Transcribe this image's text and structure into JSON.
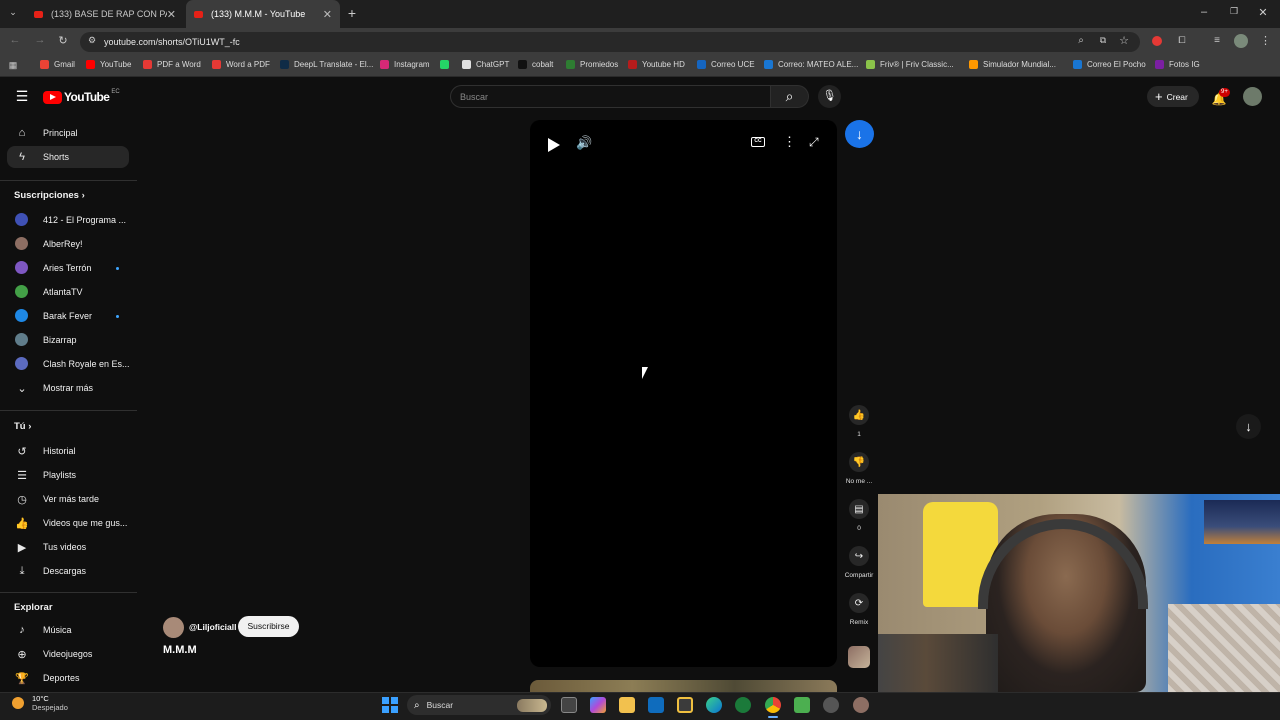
{
  "browser": {
    "tabs": [
      {
        "title": "(133) BASE DE RAP CON PALAB",
        "active": false
      },
      {
        "title": "(133) M.M.M - YouTube",
        "active": true
      }
    ],
    "url": "youtube.com/shorts/OTiU1WT_-fc",
    "bookmarks": [
      {
        "label": "Gmail",
        "color": "#ea4335"
      },
      {
        "label": "YouTube",
        "color": "#ff0000"
      },
      {
        "label": "PDF a Word",
        "color": "#e53935"
      },
      {
        "label": "Word a PDF",
        "color": "#e53935"
      },
      {
        "label": "DeepL Translate - El...",
        "color": "#0f2b46"
      },
      {
        "label": "Instagram",
        "color": "#d62976"
      },
      {
        "label": "",
        "color": "#25d366"
      },
      {
        "label": "ChatGPT",
        "color": "#e0e0e0"
      },
      {
        "label": "cobalt",
        "color": "#111111"
      },
      {
        "label": "Promiedos",
        "color": "#2e7d32"
      },
      {
        "label": "Youtube HD",
        "color": "#b71c1c"
      },
      {
        "label": "Correo UCE",
        "color": "#1565c0"
      },
      {
        "label": "Correo: MATEO ALE...",
        "color": "#1976d2"
      },
      {
        "label": "Friv® | Friv Classic...",
        "color": "#8bc34a"
      },
      {
        "label": "Simulador Mundial...",
        "color": "#ff9800"
      },
      {
        "label": "Correo El Pocho",
        "color": "#1976d2"
      },
      {
        "label": "Fotos IG",
        "color": "#7b1fa2"
      }
    ]
  },
  "youtube": {
    "logo_text": "YouTube",
    "logo_region": "EC",
    "search_placeholder": "Buscar",
    "create_label": "Crear",
    "notif_badge": "9+",
    "sidebar": {
      "main": [
        {
          "label": "Principal",
          "icon": "home-icon"
        },
        {
          "label": "Shorts",
          "icon": "shorts-icon",
          "active": true
        }
      ],
      "subs_title": "Suscripciones",
      "subs": [
        {
          "label": "412 - El Programa ...",
          "color": "#3f51b5",
          "dot": false
        },
        {
          "label": "AlberRey!",
          "color": "#8d6e63",
          "dot": false
        },
        {
          "label": "Aries Terrón",
          "color": "#7e57c2",
          "dot": true
        },
        {
          "label": "AtlantaTV",
          "color": "#43a047",
          "dot": false
        },
        {
          "label": "Barak Fever",
          "color": "#1e88e5",
          "dot": true
        },
        {
          "label": "Bizarrap",
          "color": "#607d8b",
          "dot": false
        },
        {
          "label": "Clash Royale en Es...",
          "color": "#5c6bc0",
          "dot": false
        }
      ],
      "show_more": "Mostrar más",
      "you_title": "Tú",
      "you": [
        {
          "label": "Historial",
          "icon": "history-icon"
        },
        {
          "label": "Playlists",
          "icon": "playlists-icon"
        },
        {
          "label": "Ver más tarde",
          "icon": "watch-later-icon"
        },
        {
          "label": "Videos que me gus...",
          "icon": "liked-videos-icon"
        },
        {
          "label": "Tus videos",
          "icon": "your-videos-icon"
        },
        {
          "label": "Descargas",
          "icon": "downloads-icon"
        }
      ],
      "explore_title": "Explorar",
      "explore": [
        {
          "label": "Música",
          "icon": "music-icon"
        },
        {
          "label": "Videojuegos",
          "icon": "gaming-icon"
        },
        {
          "label": "Deportes",
          "icon": "sports-icon"
        }
      ]
    },
    "short": {
      "channel": "@Liljoficiall",
      "subscribe": "Suscribirse",
      "title": "M.M.M",
      "actions": [
        {
          "icon": "like-icon",
          "label": "1"
        },
        {
          "icon": "dislike-icon",
          "label": "No me ..."
        },
        {
          "icon": "comments-icon",
          "label": "0"
        },
        {
          "icon": "share-icon",
          "label": "Compartir"
        },
        {
          "icon": "remix-icon",
          "label": "Remix"
        }
      ]
    }
  },
  "taskbar": {
    "weather_temp": "10°C",
    "weather_desc": "Despejado",
    "search_label": "Buscar"
  }
}
